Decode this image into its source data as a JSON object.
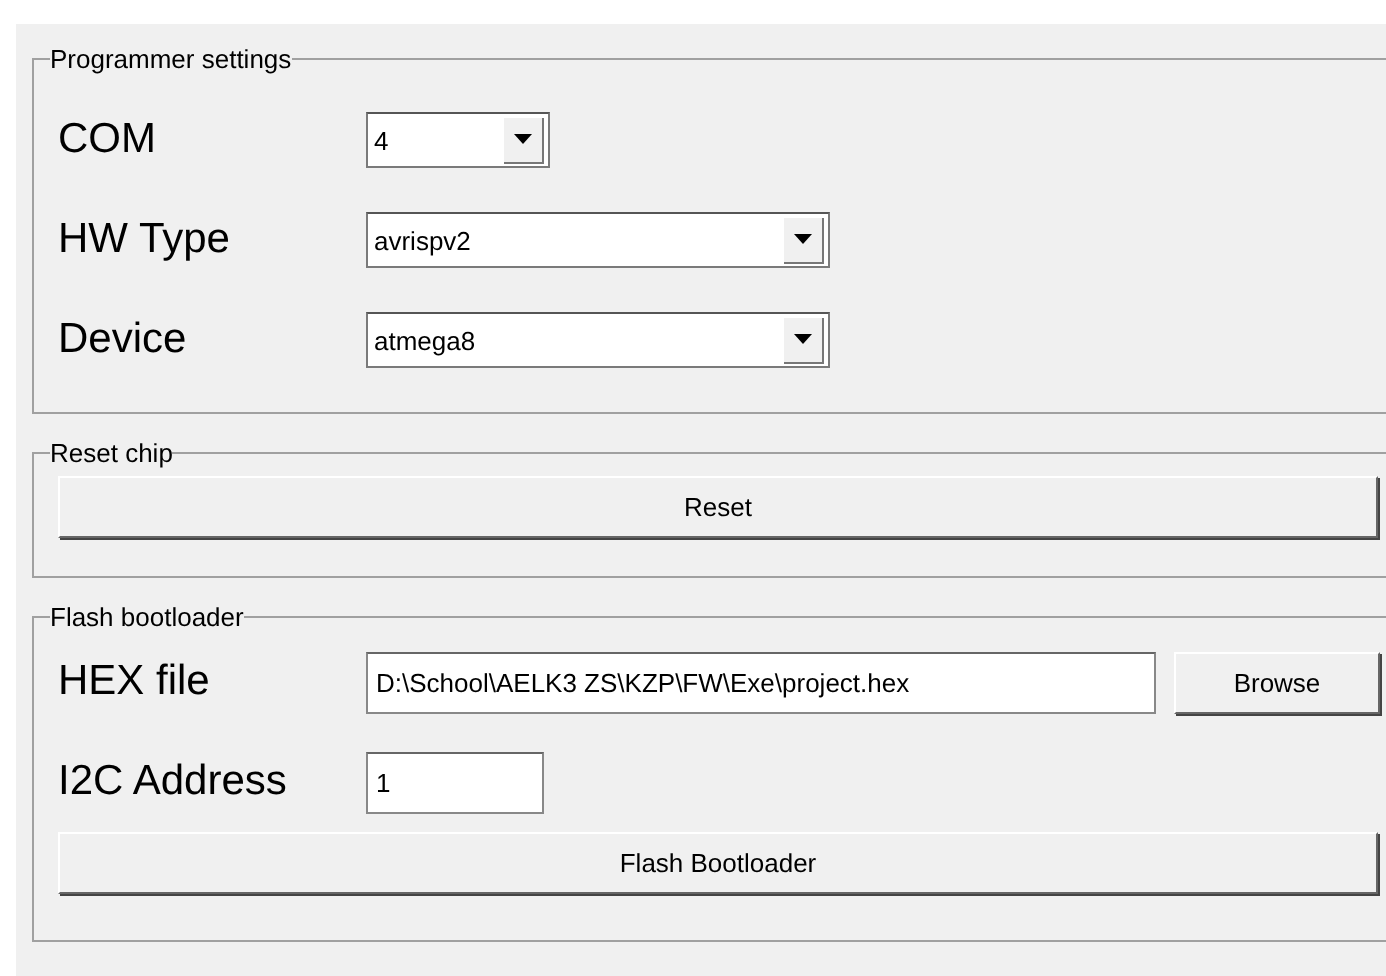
{
  "programmer_settings": {
    "title": "Programmer settings",
    "fields": [
      {
        "label": "COM",
        "value": "4"
      },
      {
        "label": "HW Type",
        "value": "avrispv2"
      },
      {
        "label": "Device",
        "value": "atmega8"
      }
    ]
  },
  "reset_chip": {
    "title": "Reset chip",
    "button": "Reset"
  },
  "flash_bootloader": {
    "title": "Flash bootloader",
    "hex_file": {
      "label": "HEX file",
      "value": "D:\\School\\AELK3 ZS\\KZP\\FW\\Exe\\project.hex"
    },
    "browse_button": "Browse",
    "i2c_address": {
      "label": "I2C Address",
      "value": "1"
    },
    "button": "Flash Bootloader"
  }
}
